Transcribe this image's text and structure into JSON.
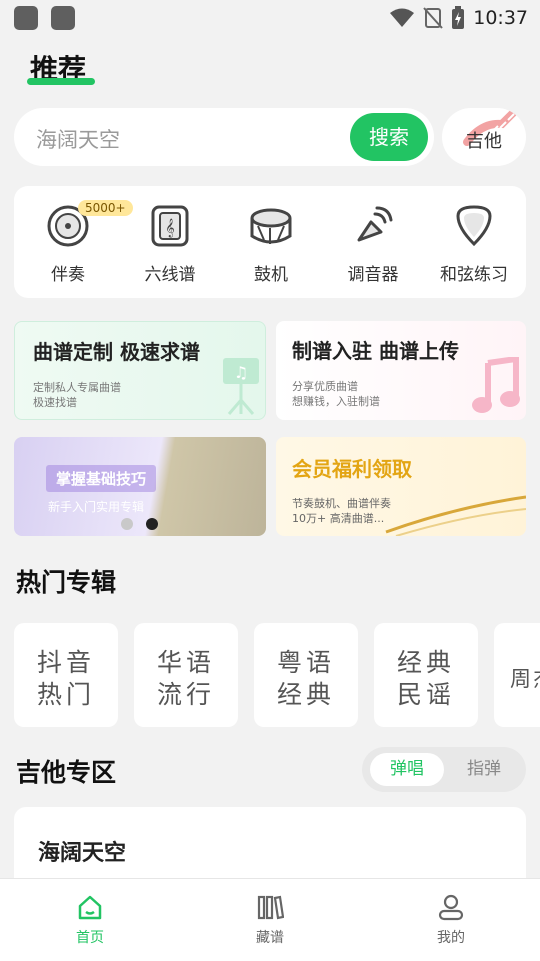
{
  "status_bar": {
    "time": "10:37",
    "wifi_icon": "wifi-icon",
    "signal_icon": "no-signal-icon",
    "battery_icon": "battery-charging-icon"
  },
  "page_title": "推荐",
  "search": {
    "placeholder": "海阔天空",
    "button_label": "搜索"
  },
  "guitar_button": {
    "label": "吉他",
    "icon": "guitar-neck-icon"
  },
  "tools": [
    {
      "label": "伴奏",
      "icon": "vinyl-record-icon",
      "badge": "5000+"
    },
    {
      "label": "六线谱",
      "icon": "sheet-music-icon"
    },
    {
      "label": "鼓机",
      "icon": "drum-icon"
    },
    {
      "label": "调音器",
      "icon": "tuner-icon"
    },
    {
      "label": "和弦练习",
      "icon": "guitar-pick-icon"
    }
  ],
  "banners": {
    "custom": {
      "title": "曲谱定制 极速求谱",
      "sub1": "定制私人专属曲谱",
      "sub2": "极速找谱"
    },
    "upload": {
      "title": "制谱入驻 曲谱上传",
      "sub1": "分享优质曲谱",
      "sub2": "想赚钱，入驻制谱"
    },
    "skills": {
      "title": "掌握基础技巧",
      "sub": "新手入门实用专辑"
    },
    "member": {
      "title": "会员福利领取",
      "sub1": "节奏鼓机、曲谱伴奏",
      "sub2": "10万+ 高清曲谱..."
    }
  },
  "hot_albums": {
    "title": "热门专辑",
    "items": [
      {
        "line1": "抖音",
        "line2": "热门"
      },
      {
        "line1": "华语",
        "line2": "流行"
      },
      {
        "line1": "粤语",
        "line2": "经典"
      },
      {
        "line1": "经典",
        "line2": "民谣"
      },
      {
        "line1": "周杰",
        "line2": ""
      }
    ]
  },
  "guitar_zone": {
    "title": "吉他专区",
    "tabs": [
      "弹唱",
      "指弹"
    ],
    "first_song": "海阔天空"
  },
  "nav": [
    {
      "label": "首页",
      "icon": "home-icon",
      "active": true
    },
    {
      "label": "藏谱",
      "icon": "library-icon",
      "active": false
    },
    {
      "label": "我的",
      "icon": "user-icon",
      "active": false
    }
  ],
  "colors": {
    "accent": "#22c463",
    "gold": "#e3a514"
  }
}
